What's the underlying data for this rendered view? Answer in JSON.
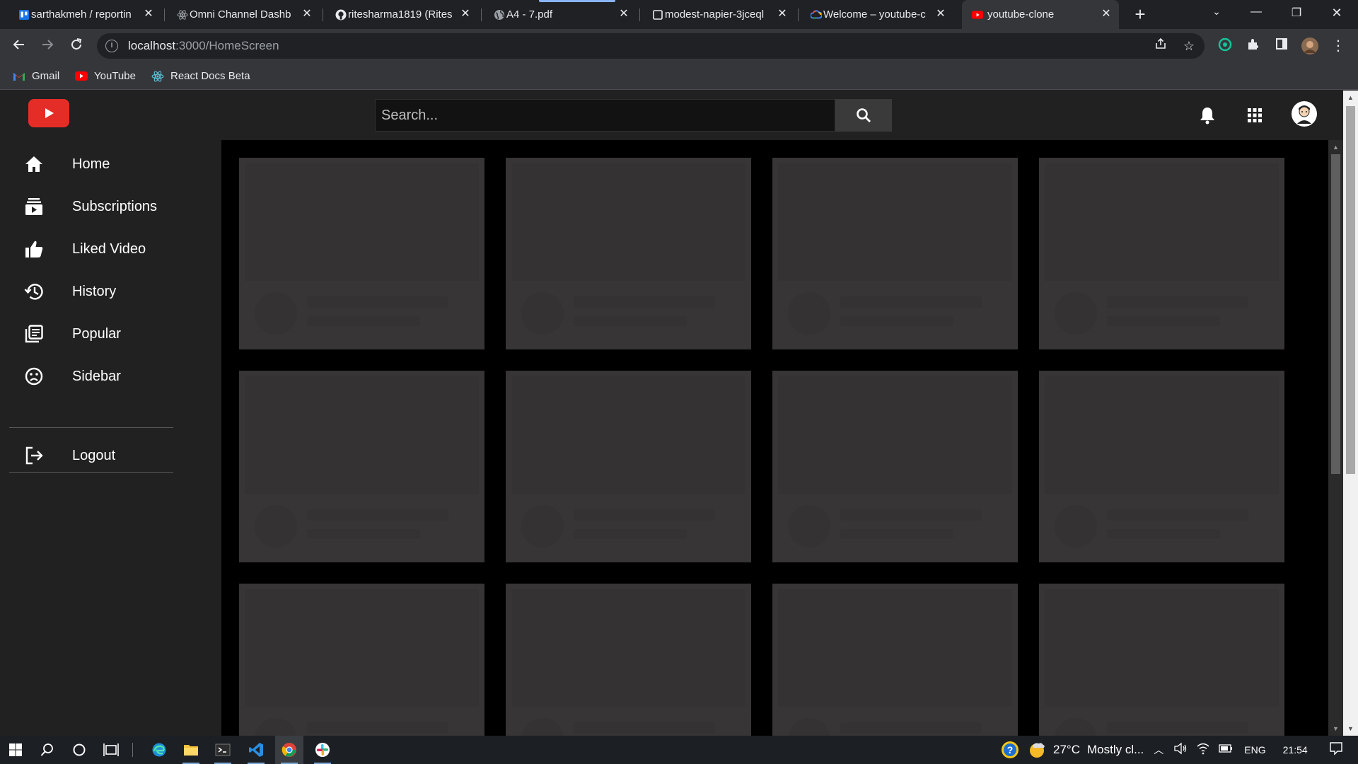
{
  "browser": {
    "tabs": [
      {
        "title": "sarthakmeh / reportin",
        "icon": "trello-icon"
      },
      {
        "title": "Omni Channel Dashb",
        "icon": "react-icon"
      },
      {
        "title": "ritesharma1819 (Rites",
        "icon": "github-icon"
      },
      {
        "title": "A4 - 7.pdf",
        "icon": "globe-icon"
      },
      {
        "title": "modest-napier-3jceql",
        "icon": "page-icon"
      },
      {
        "title": "Welcome – youtube-c",
        "icon": "google-cloud-icon"
      },
      {
        "title": "youtube-clone",
        "icon": "youtube-icon",
        "active": true
      }
    ],
    "url_host": "localhost",
    "url_path": ":3000/HomeScreen",
    "bookmarks": [
      {
        "label": "Gmail",
        "icon": "gmail-icon"
      },
      {
        "label": "YouTube",
        "icon": "youtube-icon"
      },
      {
        "label": "React Docs Beta",
        "icon": "react-icon"
      }
    ]
  },
  "app": {
    "search": {
      "placeholder": "Search..."
    },
    "sidebar": {
      "items": [
        {
          "label": "Home",
          "icon": "home-icon"
        },
        {
          "label": "Subscriptions",
          "icon": "subscriptions-icon"
        },
        {
          "label": "Liked Video",
          "icon": "thumbs-up-icon"
        },
        {
          "label": "History",
          "icon": "history-icon"
        },
        {
          "label": "Popular",
          "icon": "library-icon"
        },
        {
          "label": "Sidebar",
          "icon": "sad-face-icon"
        }
      ],
      "logout_label": "Logout"
    },
    "skeleton_card_count": 12,
    "colors": {
      "brand_red": "#e52d27",
      "header_bg": "#212121",
      "content_bg": "#000000",
      "skeleton": "#373535"
    }
  },
  "taskbar": {
    "weather_temp": "27°C",
    "weather_desc": "Mostly cl...",
    "language": "ENG",
    "time": "21:54"
  }
}
